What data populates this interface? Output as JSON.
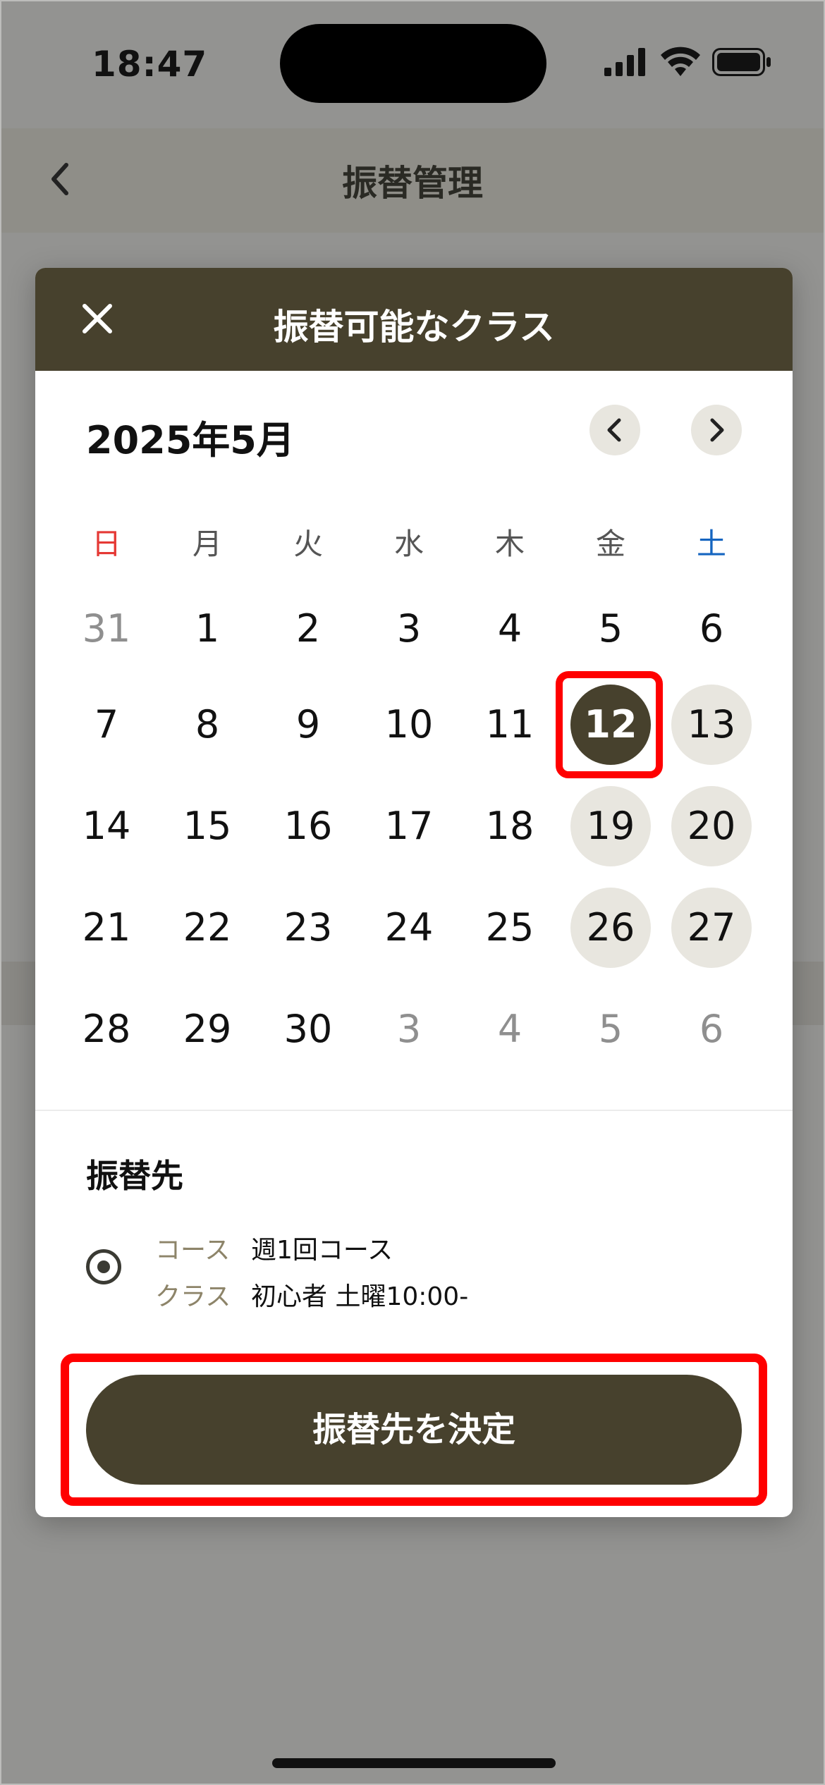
{
  "status_bar": {
    "time": "18:47"
  },
  "nav": {
    "title": "振替管理"
  },
  "modal": {
    "title": "振替可能なクラス",
    "month_label": "2025年5月"
  },
  "calendar": {
    "weekdays": [
      {
        "label": "日",
        "color": "#e53935"
      },
      {
        "label": "月",
        "color": "#555555"
      },
      {
        "label": "火",
        "color": "#555555"
      },
      {
        "label": "水",
        "color": "#555555"
      },
      {
        "label": "木",
        "color": "#555555"
      },
      {
        "label": "金",
        "color": "#555555"
      },
      {
        "label": "土",
        "color": "#1565c0"
      }
    ],
    "weeks": [
      [
        {
          "d": "31",
          "state": "muted"
        },
        {
          "d": "1",
          "state": "normal"
        },
        {
          "d": "2",
          "state": "normal"
        },
        {
          "d": "3",
          "state": "normal"
        },
        {
          "d": "4",
          "state": "normal"
        },
        {
          "d": "5",
          "state": "normal"
        },
        {
          "d": "6",
          "state": "normal"
        }
      ],
      [
        {
          "d": "7",
          "state": "normal"
        },
        {
          "d": "8",
          "state": "normal"
        },
        {
          "d": "9",
          "state": "normal"
        },
        {
          "d": "10",
          "state": "normal"
        },
        {
          "d": "11",
          "state": "normal"
        },
        {
          "d": "12",
          "state": "selected"
        },
        {
          "d": "13",
          "state": "available"
        }
      ],
      [
        {
          "d": "14",
          "state": "normal"
        },
        {
          "d": "15",
          "state": "normal"
        },
        {
          "d": "16",
          "state": "normal"
        },
        {
          "d": "17",
          "state": "normal"
        },
        {
          "d": "18",
          "state": "normal"
        },
        {
          "d": "19",
          "state": "available"
        },
        {
          "d": "20",
          "state": "available"
        }
      ],
      [
        {
          "d": "21",
          "state": "normal"
        },
        {
          "d": "22",
          "state": "normal"
        },
        {
          "d": "23",
          "state": "normal"
        },
        {
          "d": "24",
          "state": "normal"
        },
        {
          "d": "25",
          "state": "normal"
        },
        {
          "d": "26",
          "state": "available"
        },
        {
          "d": "27",
          "state": "available"
        }
      ],
      [
        {
          "d": "28",
          "state": "normal"
        },
        {
          "d": "29",
          "state": "normal"
        },
        {
          "d": "30",
          "state": "normal"
        },
        {
          "d": "3",
          "state": "muted"
        },
        {
          "d": "4",
          "state": "muted"
        },
        {
          "d": "5",
          "state": "muted"
        },
        {
          "d": "6",
          "state": "muted"
        }
      ]
    ]
  },
  "destination": {
    "title": "振替先",
    "course_key": "コース",
    "course_val": "週1回コース",
    "class_key": "クラス",
    "class_val": "初心者 土曜10:00-"
  },
  "confirm_button_label": "振替先を決定",
  "colors": {
    "accent": "#47412d",
    "available_bg": "#e8e6df",
    "highlight": "#ff0000"
  }
}
